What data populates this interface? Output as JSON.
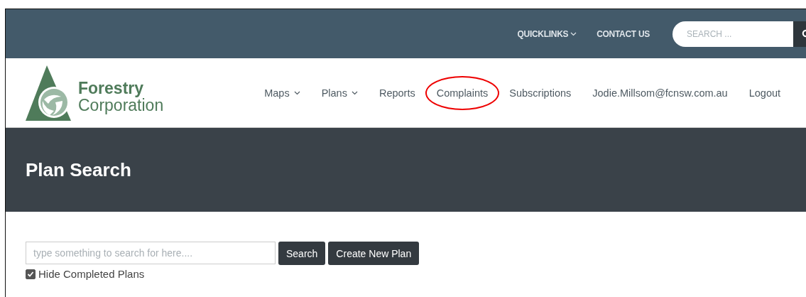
{
  "top_bar": {
    "links": [
      {
        "label": "QUICKLINKS",
        "dropdown": true
      },
      {
        "label": "CONTACT US",
        "dropdown": false
      }
    ],
    "search": {
      "placeholder": "SEARCH ..."
    }
  },
  "logo": {
    "line_1": "Forestry",
    "line_2": "Corporation"
  },
  "nav": [
    {
      "label": "Maps",
      "dropdown": true,
      "highlighted": false
    },
    {
      "label": "Plans",
      "dropdown": true,
      "highlighted": false
    },
    {
      "label": "Reports",
      "dropdown": false,
      "highlighted": false
    },
    {
      "label": "Complaints",
      "dropdown": false,
      "highlighted": true
    },
    {
      "label": "Subscriptions",
      "dropdown": false,
      "highlighted": false
    },
    {
      "label": "Jodie.Millsom@fcnsw.com.au",
      "dropdown": false,
      "highlighted": false
    },
    {
      "label": "Logout",
      "dropdown": false,
      "highlighted": false
    }
  ],
  "banner": {
    "title": "Plan Search"
  },
  "search_form": {
    "placeholder": "type something to search for here....",
    "buttons": [
      "Search",
      "Create New Plan"
    ],
    "hide_completed": {
      "label": "Hide Completed Plans",
      "checked": true
    }
  }
}
